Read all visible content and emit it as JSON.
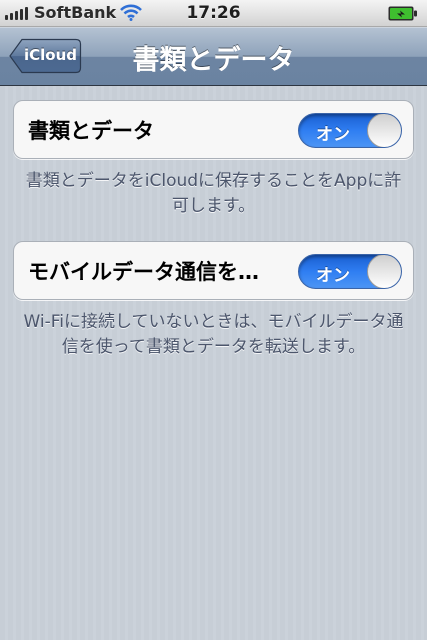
{
  "status_bar": {
    "carrier": "SoftBank",
    "time": "17:26",
    "icons": [
      "signal-icon",
      "wifi-icon",
      "battery-icon"
    ]
  },
  "nav": {
    "back_label": "iCloud",
    "title": "書類とデータ"
  },
  "settings": [
    {
      "label": "書類とデータ",
      "toggle": "オン",
      "footer": "書類とデータをiCloudに保存することをAppに許可します。"
    },
    {
      "label": "モバイルデータ通信を…",
      "toggle": "オン",
      "footer": "Wi-Fiに接続していないときは、モバイルデータ通信を使って書類とデータを転送します。"
    }
  ],
  "colors": {
    "navbar": "#6d84a2",
    "switch_on": "#2f7ef2",
    "background": "#c5ccd4"
  }
}
